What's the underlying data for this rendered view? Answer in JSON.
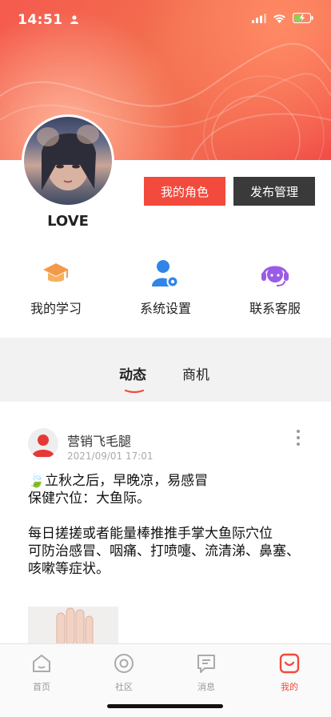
{
  "status_bar": {
    "time": "14:51"
  },
  "profile": {
    "username": "LOVE",
    "role_button": "我的角色",
    "publish_button": "发布管理"
  },
  "quick_actions": [
    {
      "label": "我的学习",
      "icon": "graduation-cap-icon"
    },
    {
      "label": "系统设置",
      "icon": "user-settings-icon"
    },
    {
      "label": "联系客服",
      "icon": "headset-icon"
    }
  ],
  "tabs": [
    {
      "label": "动态",
      "active": true
    },
    {
      "label": "商机",
      "active": false
    }
  ],
  "post": {
    "author": "营销飞毛腿",
    "time": "2021/09/01 17:01",
    "leaf_icon": "🍃",
    "body": "立秋之后，早晚凉，易感冒\n保健穴位：大鱼际。\n\n每日搓搓或者能量棒推推手掌大鱼际穴位\n可防治感冒、咽痛、打喷嚏、流清涕、鼻塞、咳嗽等症状。"
  },
  "tabbar": [
    {
      "label": "首页",
      "icon": "home-icon",
      "active": false
    },
    {
      "label": "社区",
      "icon": "community-icon",
      "active": false
    },
    {
      "label": "消息",
      "icon": "message-icon",
      "active": false
    },
    {
      "label": "我的",
      "icon": "profile-icon",
      "active": true
    }
  ],
  "colors": {
    "accent": "#f24a3d",
    "dark_button": "#3a3a3a",
    "header": "#f2604c"
  }
}
